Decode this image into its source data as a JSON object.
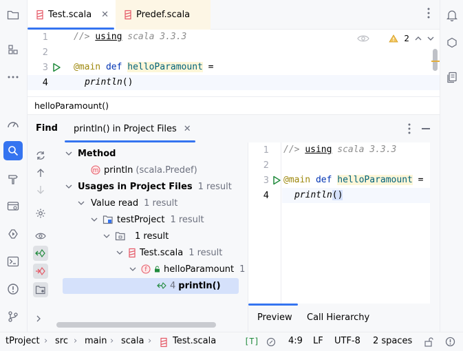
{
  "editor_tabs": [
    {
      "name": "Test.scala",
      "active": true
    },
    {
      "name": "Predef.scala",
      "active": false
    }
  ],
  "editor": {
    "lines": [
      {
        "num": "1",
        "comment": "//>",
        "directive": "using",
        "rest": " scala 3.3.3"
      },
      {
        "num": "2"
      },
      {
        "num": "3",
        "annotation": "@main",
        "keyword": "def",
        "fn": "helloParamount",
        "eq": " ="
      },
      {
        "num": "4",
        "call": "println",
        "parens": "()"
      }
    ],
    "inspection_count": "2"
  },
  "breadcrumb": "helloParamount()",
  "find": {
    "title": "Find",
    "tab_label": "println() in Project Files"
  },
  "tree": {
    "method_label": "Method",
    "method_item": "println",
    "method_item_owner": "(scala.Predef)",
    "usages_label": "Usages in Project Files",
    "usages_count": "1 result",
    "value_read": "Value read",
    "value_read_count": "1 result",
    "project": "testProject",
    "project_count": "1 result",
    "package_count": "1 result",
    "file": "Test.scala",
    "file_count": "1 result",
    "function": "helloParamount",
    "function_count": "1",
    "usage_line": "4",
    "usage_text": "println()"
  },
  "preview_tabs": [
    "Preview",
    "Call Hierarchy"
  ],
  "status": {
    "crumbs": [
      "tProject",
      "src",
      "main",
      "scala",
      "Test.scala"
    ],
    "mode": "[T]",
    "position": "4:9",
    "line_sep": "LF",
    "encoding": "UTF-8",
    "indent": "2 spaces"
  },
  "colors": {
    "accent": "#3574f0",
    "keyword": "#0033b3",
    "annotation": "#9e880d",
    "run_icon": "#208a3c",
    "error_icon": "#e55765"
  }
}
